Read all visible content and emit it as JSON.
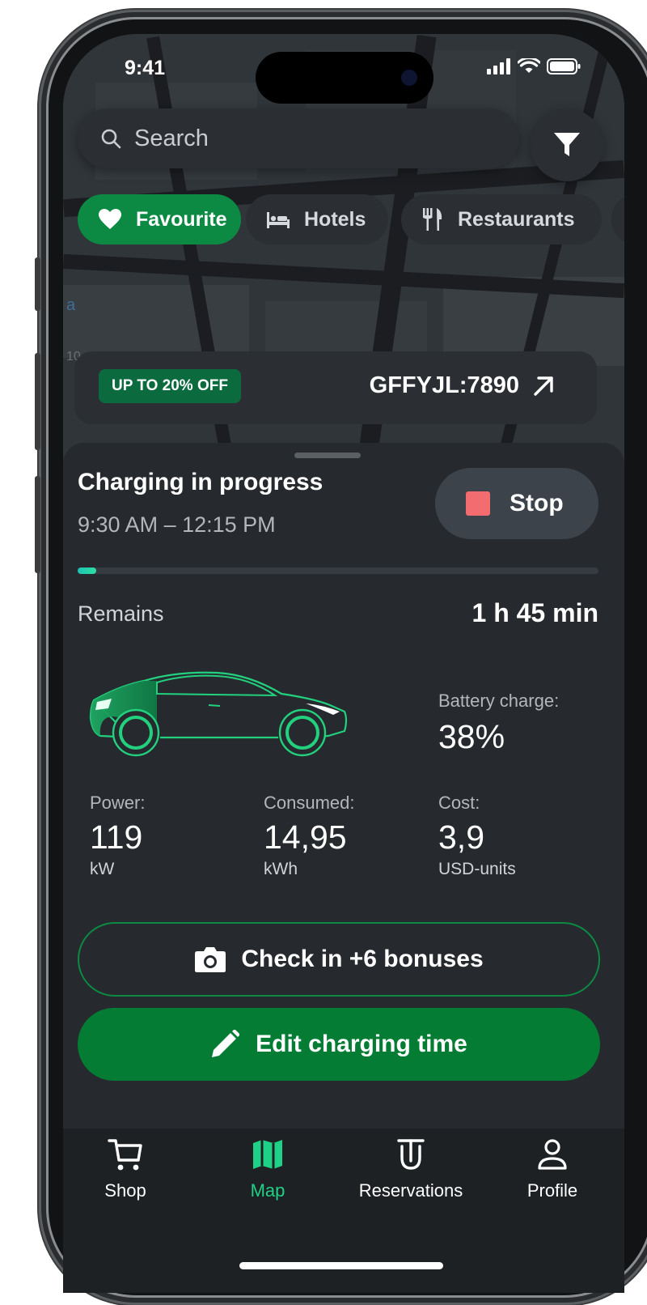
{
  "status_bar": {
    "time": "9:41"
  },
  "search": {
    "placeholder": "Search"
  },
  "chips": [
    {
      "label": "Favourite",
      "icon": "heart-icon",
      "active": true
    },
    {
      "label": "Hotels",
      "icon": "bed-icon",
      "active": false
    },
    {
      "label": "Restaurants",
      "icon": "cutlery-icon",
      "active": false
    }
  ],
  "promo": {
    "badge": "UP TO 20% OFF",
    "code": "GFFYJL:7890",
    "icon": "arrow-up-right-icon"
  },
  "charging": {
    "title": "Charging in progress",
    "time_range": "9:30 AM – 12:15 PM",
    "stop_label": "Stop",
    "progress": 0.035,
    "remains_label": "Remains",
    "remains_value": "1 h 45 min",
    "battery_label": "Battery charge:",
    "battery_value": "38%",
    "stats": [
      {
        "label": "Power:",
        "value": "119",
        "unit": "kW"
      },
      {
        "label": "Consumed:",
        "value": "14,95",
        "unit": "kWh"
      },
      {
        "label": "Cost:",
        "value": "3,9",
        "unit": "USD-units"
      }
    ],
    "checkin_label": "Check in +6 bonuses",
    "edit_label": "Edit charging time"
  },
  "tabs": [
    {
      "label": "Shop",
      "icon": "cart-icon",
      "active": false
    },
    {
      "label": "Map",
      "icon": "map-icon",
      "active": true
    },
    {
      "label": "Reservations",
      "icon": "reservation-icon",
      "active": false
    },
    {
      "label": "Profile",
      "icon": "user-icon",
      "active": false
    }
  ],
  "colors": {
    "accent": "#0c8a43",
    "accent_dark": "#047c34",
    "tab_active": "#1fd186",
    "stop_square": "#f26c70",
    "surface": "#262a2e"
  }
}
